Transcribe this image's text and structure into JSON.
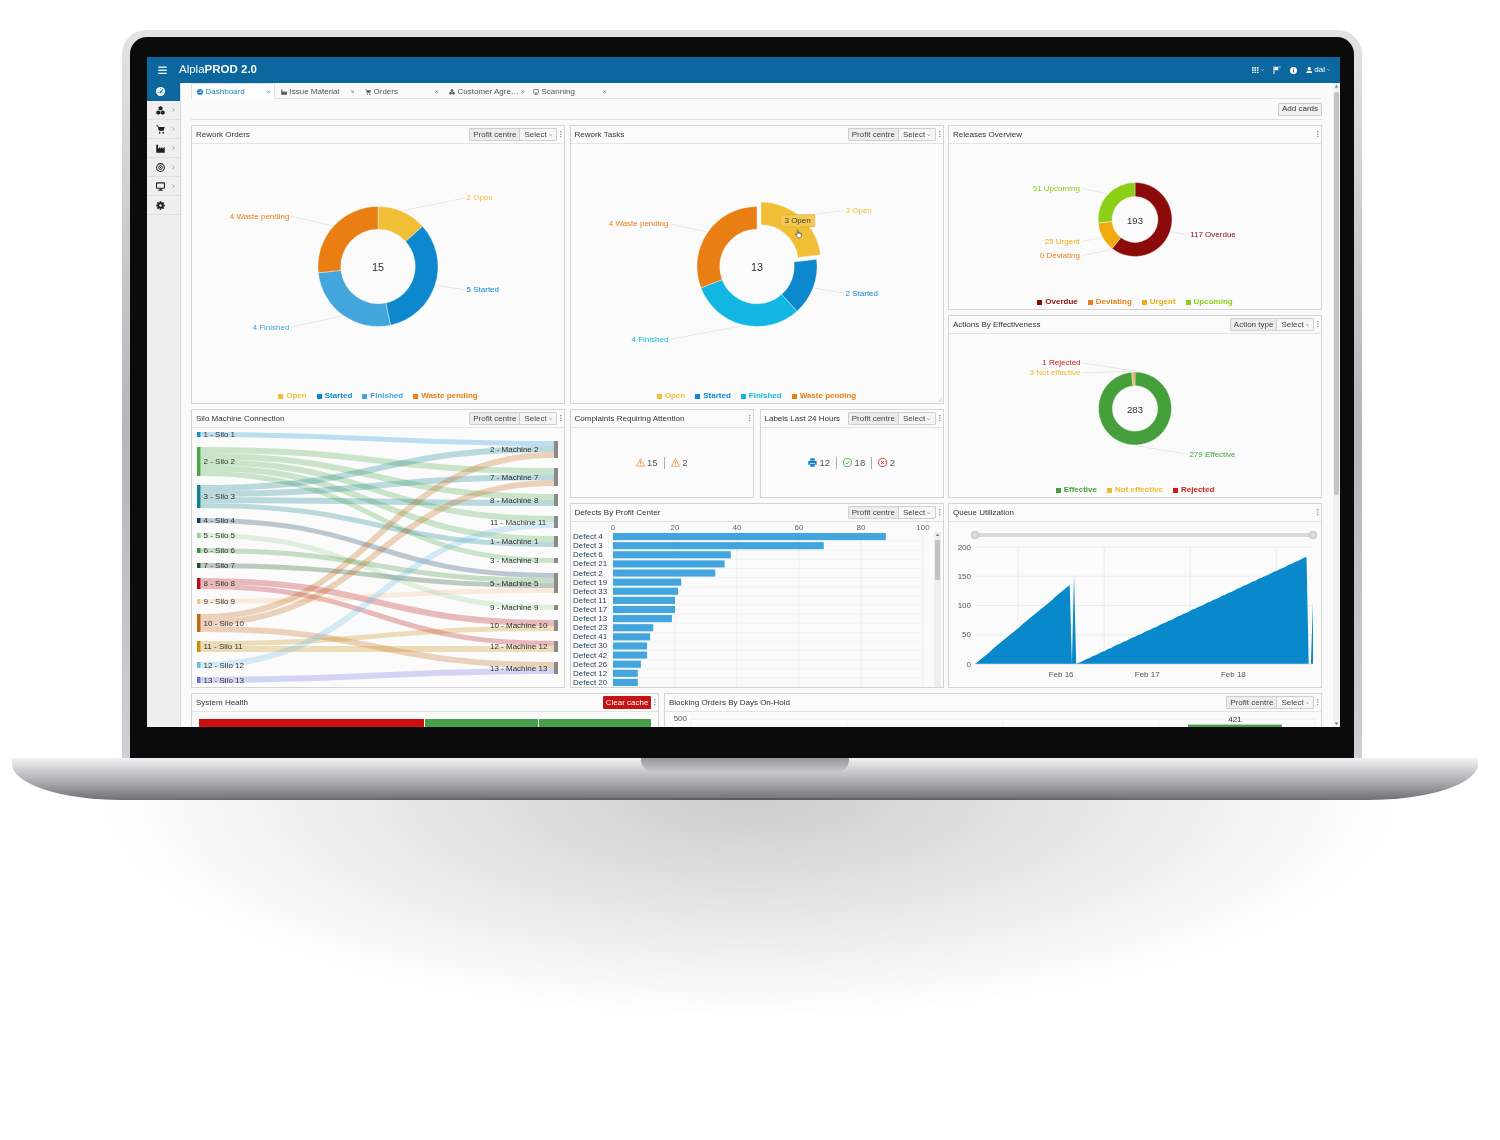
{
  "header": {
    "title": "Alpla**PROD 2.0**",
    "user": "dal"
  },
  "sidebar": {
    "items": [
      {
        "selected": true,
        "submenu": false
      },
      {
        "selected": false,
        "submenu": true
      },
      {
        "selected": false,
        "submenu": true
      },
      {
        "selected": false,
        "submenu": true
      },
      {
        "selected": false,
        "submenu": true
      },
      {
        "selected": false,
        "submenu": true
      },
      {
        "selected": false,
        "submenu": false
      }
    ]
  },
  "tabs": [
    {
      "label": "Dashboard",
      "selected": true
    },
    {
      "label": "Issue Material",
      "selected": false
    },
    {
      "label": "Orders",
      "selected": false
    },
    {
      "label": "Customer Agre…",
      "selected": false
    },
    {
      "label": "Scanning",
      "selected": false
    }
  ],
  "toolbar": {
    "button": "Add cards"
  },
  "rework_orders": {
    "title": "Rework Orders",
    "filter": {
      "label": "Profit centre",
      "select": "Select"
    },
    "total": "15",
    "slices": [
      {
        "color": "#f1bf36"
      },
      {
        "color": "#0d87cd"
      },
      {
        "color": "#42a6dc"
      },
      {
        "color": "#e97e13"
      }
    ],
    "chart_data": {
      "type": "donut",
      "categories": [
        "Open",
        "Started",
        "Finished",
        "Waste pending"
      ],
      "values": [
        2,
        5,
        4,
        4
      ],
      "value_labels": [
        "2 Open",
        "5 Started",
        "4 Finished",
        "4 Waste pending"
      ],
      "legend": true
    }
  },
  "rework_tasks": {
    "title": "Rework Tasks",
    "filter": {
      "label": "Profit centre",
      "select": "Select"
    },
    "total": "13",
    "tooltip": "3 Open",
    "slices": [
      {
        "color": "#f1bf36",
        "hovered": true
      },
      {
        "color": "#0d87cd",
        "hovered": false
      },
      {
        "color": "#11b7e2",
        "hovered": false
      },
      {
        "color": "#e97e13",
        "hovered": false
      }
    ],
    "chart_data": {
      "type": "donut",
      "categories": [
        "Open",
        "Started",
        "Finished",
        "Waste pending"
      ],
      "values": [
        3,
        2,
        4,
        4
      ],
      "value_labels": [
        "3 Open",
        "2 Started",
        "4 Finished",
        "4 Waste pending"
      ],
      "legend": true
    }
  },
  "releases_overview": {
    "title": "Releases Overview",
    "total": "193",
    "slices": [
      {
        "color": "#8b0b0b"
      },
      {
        "color": "#e8801a"
      },
      {
        "color": "#efab10"
      },
      {
        "color": "#8ccf17"
      }
    ],
    "chart_data": {
      "type": "donut",
      "categories": [
        "Overdue",
        "Deviating",
        "Urgent",
        "Upcoming"
      ],
      "values": [
        117,
        0,
        25,
        51
      ],
      "value_labels": [
        "117 Overdue",
        "0 Deviating",
        "25 Urgent",
        "51 Upcoming"
      ],
      "legend": true
    }
  },
  "actions_by_effectiveness": {
    "title": "Actions By Effectiveness",
    "filter": {
      "label": "Action type",
      "select": "Select"
    },
    "total": "283",
    "slices": [
      {
        "color": "#45a03c"
      },
      {
        "color": "#f0b730"
      },
      {
        "color": "#cc1a1a"
      }
    ],
    "chart_data": {
      "type": "donut",
      "categories": [
        "Effective",
        "Not effective",
        "Rejected"
      ],
      "values": [
        279,
        3,
        1
      ],
      "value_labels": [
        "279 Effective",
        "3 Not effective",
        "1 Rejected"
      ],
      "legend": true
    }
  },
  "silo_machine_connection": {
    "title": "Silo Machine Connection",
    "filter": {
      "label": "Profit centre",
      "select": "Select"
    },
    "sources": [
      {
        "label": "1 - Silo 1",
        "color": "#1b8fd8"
      },
      {
        "label": "2 - Silo 2",
        "color": "#49a845"
      },
      {
        "label": "3 - Silo 3",
        "color": "#13818b"
      },
      {
        "label": "4 - Silo 4",
        "color": "#163f66"
      },
      {
        "label": "5 - Silo 5",
        "color": "#98d294"
      },
      {
        "label": "6 - Silo 6",
        "color": "#3b8d39"
      },
      {
        "label": "7 - Silo 7",
        "color": "#1e4d22"
      },
      {
        "label": "8 - Silo 8",
        "color": "#b80b12"
      },
      {
        "label": "9 - Silo 9",
        "color": "#f5c08c"
      },
      {
        "label": "10 - Silo 10",
        "color": "#c2650f"
      },
      {
        "label": "11 - Silo 11",
        "color": "#c88d0b"
      },
      {
        "label": "12 - Silo 12",
        "color": "#6bbbe6"
      },
      {
        "label": "13 - Silo 13",
        "color": "#6b6ee2"
      }
    ],
    "targets": [
      {
        "label": "2 - Machine 2"
      },
      {
        "label": "7 - Machine 7"
      },
      {
        "label": "8 - Machine 8"
      },
      {
        "label": "11 - Machine 11"
      },
      {
        "label": "1 - Machine 1"
      },
      {
        "label": "3 - Machine 3"
      },
      {
        "label": "5 - Machine 5"
      },
      {
        "label": "9 - Machine 9"
      },
      {
        "label": "10 - Machine 10"
      },
      {
        "label": "12 - Machine 12"
      },
      {
        "label": "13 - Machine 13"
      }
    ]
  },
  "complaints_requiring_attention": {
    "title": "Complaints Requiring Attention",
    "items": [
      {
        "kind": "warning",
        "count": "15"
      },
      {
        "kind": "warning",
        "count": "2"
      }
    ]
  },
  "labels_last_24_hours": {
    "title": "Labels Last 24 Hours",
    "filter": {
      "label": "Profit centre",
      "select": "Select"
    },
    "items": [
      {
        "kind": "printed",
        "count": "12"
      },
      {
        "kind": "ok",
        "count": "18"
      },
      {
        "kind": "failed",
        "count": "2"
      }
    ]
  },
  "defects_by_profit_center": {
    "title": "Defects By Profit Center",
    "filter": {
      "label": "Profit centre",
      "select": "Select"
    },
    "chart_data": {
      "type": "bar",
      "orientation": "horizontal",
      "categories": [
        "Defect 4",
        "Defect 3",
        "Defect 6",
        "Defect 21",
        "Defect 2",
        "Defect 19",
        "Defect 33",
        "Defect 11",
        "Defect 17",
        "Defect 13",
        "Defect 23",
        "Defect 41",
        "Defect 30",
        "Defect 42",
        "Defect 26",
        "Defect 12",
        "Defect 20"
      ],
      "series": [
        {
          "color": "#42a5dd",
          "values": [
            88,
            68,
            38,
            36,
            33,
            22,
            21,
            20,
            20,
            19,
            13,
            12,
            11,
            11,
            9,
            8,
            8
          ]
        }
      ],
      "xlim": [
        0,
        100
      ],
      "xticks": [
        0,
        20,
        40,
        60,
        80,
        100
      ],
      "grid": true
    }
  },
  "queue_utilization": {
    "title": "Queue Utilization",
    "chart_data": {
      "type": "area",
      "categories": [
        null,
        null,
        null,
        null,
        null,
        null,
        null,
        null,
        null,
        null,
        null,
        null,
        null,
        null,
        null,
        null,
        null,
        null,
        null,
        null,
        null,
        null,
        null,
        null,
        null,
        null,
        null,
        null,
        null,
        null,
        null,
        null,
        null,
        null,
        null,
        null,
        null,
        null,
        null,
        null,
        "Feb 16",
        null,
        null,
        null,
        null,
        null,
        null,
        null,
        null,
        null,
        null,
        null,
        null,
        null,
        null,
        null,
        null,
        null,
        null,
        null,
        null,
        null,
        null,
        null,
        null,
        null,
        null,
        null,
        null,
        null,
        null,
        null,
        null,
        null,
        null,
        null,
        null,
        null,
        null,
        null,
        "Feb 17",
        null,
        null,
        null,
        null,
        null,
        null,
        null,
        null,
        null,
        null,
        null,
        null,
        null,
        null,
        null,
        null,
        null,
        null,
        null,
        null,
        null,
        null,
        null,
        null,
        null,
        null,
        null,
        null,
        null,
        null,
        null,
        null,
        null,
        null,
        null,
        null,
        null,
        null,
        null,
        "Feb 18",
        null,
        null,
        null,
        null,
        null,
        null,
        null,
        null,
        null,
        null,
        null,
        null,
        null,
        null,
        null,
        null,
        null,
        null,
        null,
        null,
        null,
        null,
        null,
        null,
        null,
        null,
        null,
        null,
        null,
        null,
        null,
        null,
        null,
        null,
        null,
        null,
        null
      ],
      "series": [
        {
          "color": "#0a88cc",
          "values": [
            0,
            3,
            6,
            9,
            12,
            15,
            18,
            21,
            25,
            28,
            31,
            34,
            37,
            40,
            43,
            46,
            49,
            52,
            55,
            58,
            61,
            64,
            68,
            71,
            74,
            77,
            80,
            83,
            86,
            89,
            92,
            95,
            98,
            101,
            104,
            107,
            110,
            114,
            117,
            120,
            123,
            126,
            129,
            132,
            135,
            0,
            153,
            0,
            2,
            3,
            5,
            7,
            9,
            10,
            12,
            14,
            15,
            17,
            19,
            21,
            22,
            24,
            26,
            27,
            29,
            31,
            33,
            34,
            36,
            38,
            39,
            41,
            43,
            45,
            46,
            48,
            50,
            51,
            53,
            55,
            57,
            58,
            60,
            62,
            63,
            65,
            67,
            69,
            70,
            72,
            74,
            75,
            77,
            79,
            81,
            82,
            84,
            86,
            87,
            89,
            91,
            93,
            94,
            96,
            98,
            99,
            101,
            103,
            105,
            106,
            108,
            110,
            111,
            113,
            115,
            117,
            118,
            120,
            122,
            123,
            125,
            127,
            129,
            130,
            132,
            134,
            135,
            137,
            139,
            141,
            142,
            144,
            146,
            147,
            149,
            151,
            152,
            154,
            156,
            158,
            159,
            161,
            163,
            164,
            166,
            168,
            170,
            171,
            173,
            175,
            176,
            178,
            180,
            182,
            183,
            0,
            0,
            105
          ]
        }
      ],
      "ylim": [
        0,
        200
      ],
      "yticks": [
        0,
        50,
        100,
        150,
        200
      ],
      "grid": true
    }
  },
  "system_health": {
    "title": "System Health",
    "button": "Clear cache",
    "tiles": [
      {
        "color": "#c8110f",
        "wide": true
      },
      {
        "color": "#45a048",
        "wide": false
      },
      {
        "color": "#45a048",
        "wide": false
      }
    ]
  },
  "blocking_orders_by_days_on_hold": {
    "title": "Blocking Orders By Days On-Hold",
    "filter": {
      "label": "Profit centre",
      "select": "Select"
    },
    "y_tick": "500",
    "bar_label": "421"
  }
}
